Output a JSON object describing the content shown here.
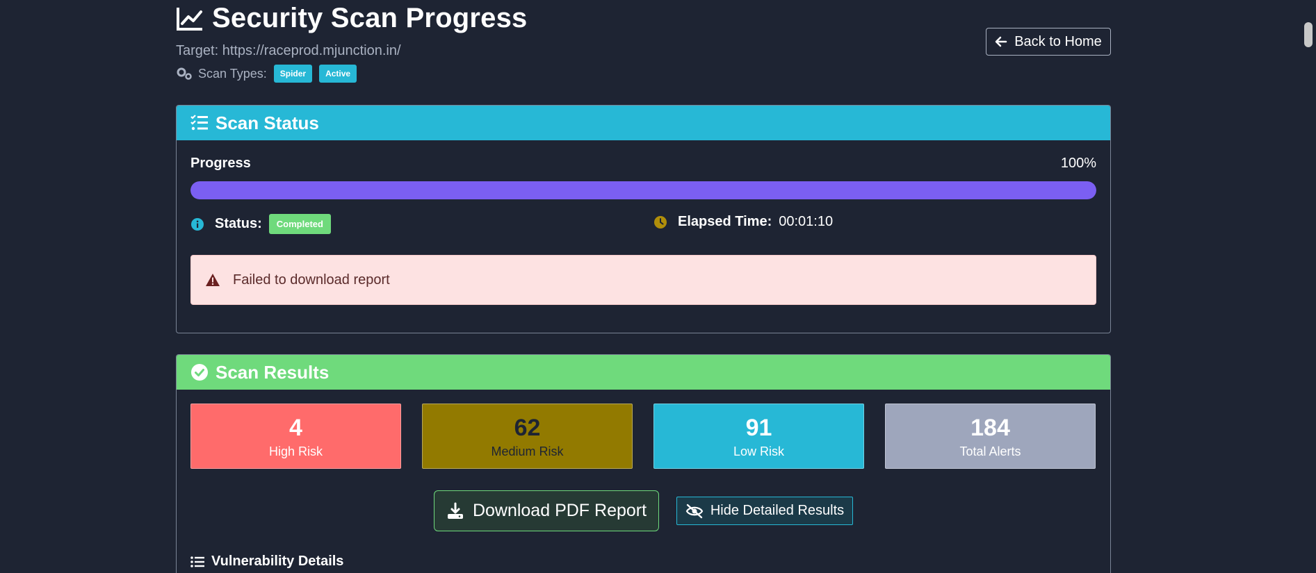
{
  "header": {
    "title": "Security Scan Progress",
    "target": "Target: https://raceprod.mjunction.in/",
    "scan_types_label": "Scan Types:",
    "scan_types": [
      "Spider",
      "Active"
    ],
    "back_button": "Back to Home"
  },
  "status_card": {
    "title": "Scan Status",
    "progress_label": "Progress",
    "progress_text": "100%",
    "progress_fraction": 1.0,
    "status_label": "Status:",
    "status_value": "Completed",
    "elapsed_label": "Elapsed Time:",
    "elapsed_value": "00:01:10",
    "alert_text": "Failed to download report"
  },
  "results_card": {
    "title": "Scan Results",
    "stats": [
      {
        "value": "4",
        "label": "High Risk"
      },
      {
        "value": "62",
        "label": "Medium Risk"
      },
      {
        "value": "91",
        "label": "Low Risk"
      },
      {
        "value": "184",
        "label": "Total Alerts"
      }
    ],
    "download_button": "Download PDF Report",
    "hide_button": "Hide Detailed Results",
    "vuln_title": "Vulnerability Details"
  },
  "colors": {
    "background": "#1e2433",
    "info": "#27b8d6",
    "success": "#6fda7c",
    "danger": "#ff6b6b",
    "warning": "#927a00",
    "progress": "#7b5ff2"
  },
  "icons": {
    "title": "chart-line-icon",
    "scan_types": "gears-icon",
    "back": "arrow-left-icon",
    "status_head": "list-check-icon",
    "status": "info-circle-icon",
    "elapsed": "clock-icon",
    "alert": "warning-triangle-icon",
    "results_head": "check-circle-icon",
    "download": "download-icon",
    "hide": "eye-slash-icon",
    "vuln": "list-icon"
  }
}
